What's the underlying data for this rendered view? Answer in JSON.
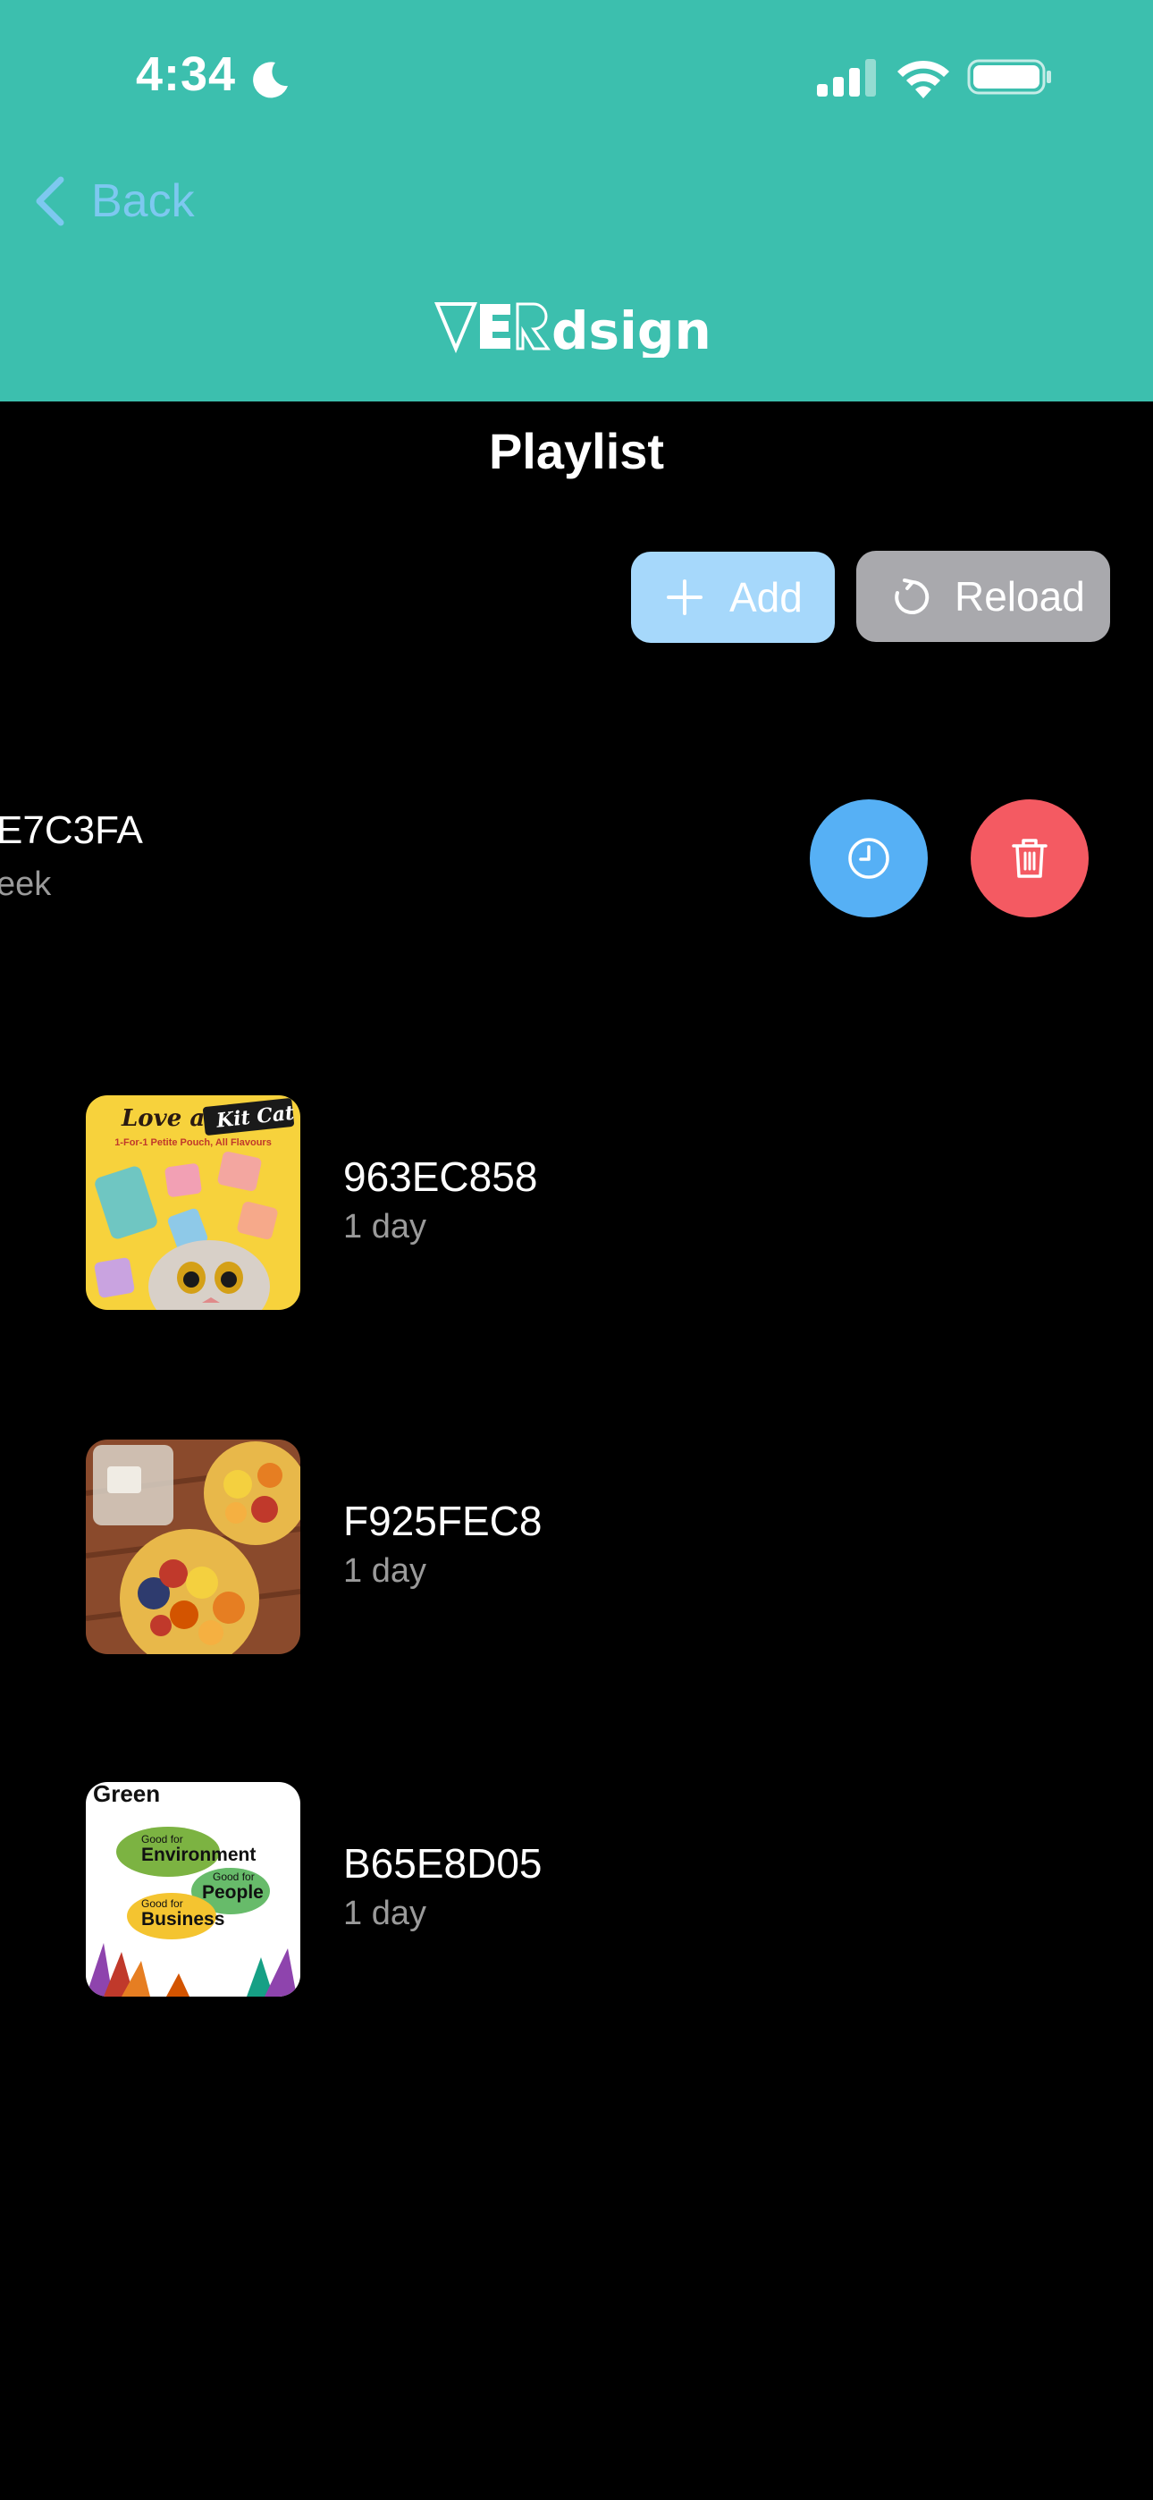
{
  "status_bar": {
    "time": "4:34"
  },
  "nav": {
    "back_label": "Back",
    "logo_text": "VERdsign"
  },
  "page": {
    "title": "Playlist"
  },
  "toolbar": {
    "add_label": "Add",
    "reload_label": "Reload"
  },
  "swiped_item": {
    "id": "E7C3FA",
    "duration": "eek"
  },
  "items": [
    {
      "id": "963EC858",
      "duration": "1 day"
    },
    {
      "id": "F925FEC8",
      "duration": "1 day"
    },
    {
      "id": "B65E8D05",
      "duration": "1 day"
    }
  ],
  "thumbnails": {
    "kitcat": {
      "headline": "Love a",
      "brand": "Kit Cat",
      "tagline": "1-For-1 Petite Pouch, All Flavours"
    },
    "green": {
      "top": "Green",
      "line1_small": "Good for",
      "line1": "Environment",
      "line2_small": "Good for",
      "line2": "People",
      "line3_small": "Good for",
      "line3": "Business"
    }
  },
  "colors": {
    "header": "#3cbfae",
    "add_button": "#a6d8fb",
    "reload_button": "#a9a9ad",
    "schedule": "#56b0f5",
    "delete": "#f45a62"
  }
}
